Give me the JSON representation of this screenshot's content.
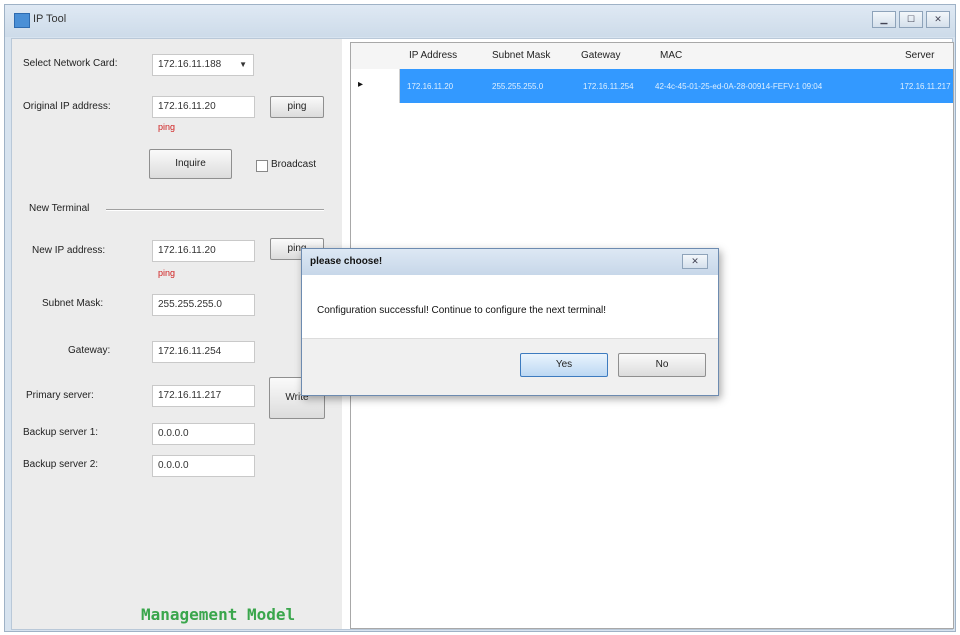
{
  "window": {
    "title": "IP Tool"
  },
  "form": {
    "network_card_label": "Select Network Card:",
    "network_card_value": "172.16.11.188",
    "original_ip_label": "Original IP address:",
    "original_ip_value": "172.16.11.20",
    "ping_label": "ping",
    "ping_status_1": "ping",
    "inquire_label": "Inquire",
    "broadcast_label": "Broadcast",
    "new_terminal_label": "New Terminal",
    "new_ip_label": "New IP address:",
    "new_ip_value": "172.16.11.20",
    "ping_status_2": "ping",
    "subnet_label": "Subnet Mask:",
    "subnet_value": "255.255.255.0",
    "gateway_label": "Gateway:",
    "gateway_value": "172.16.11.254",
    "primary_label": "Primary server:",
    "primary_value": "172.16.11.217",
    "write_label": "Write",
    "backup1_label": "Backup server 1:",
    "backup1_value": "0.0.0.0",
    "backup2_label": "Backup server 2:",
    "backup2_value": "0.0.0.0",
    "mode_label": "Management Model"
  },
  "table": {
    "headers": [
      "IP Address",
      "Subnet Mask",
      "Gateway",
      "MAC",
      "Server"
    ],
    "rows": [
      {
        "marker": "▸",
        "ip": "172.16.11.20",
        "mask": "255.255.255.0",
        "gateway": "172.16.11.254",
        "mac": "42-4c-45-01-25-ed-0A-28-00914-FEFV-1 09:04",
        "server": "172.16.11.217"
      }
    ]
  },
  "dialog": {
    "title": "please choose!",
    "message": "Configuration successful! Continue to configure the next terminal!",
    "yes_label": "Yes",
    "no_label": "No"
  },
  "colors": {
    "selection": "#3399ff",
    "mode_text": "#3aa64c",
    "ping_status": "#d02020"
  }
}
